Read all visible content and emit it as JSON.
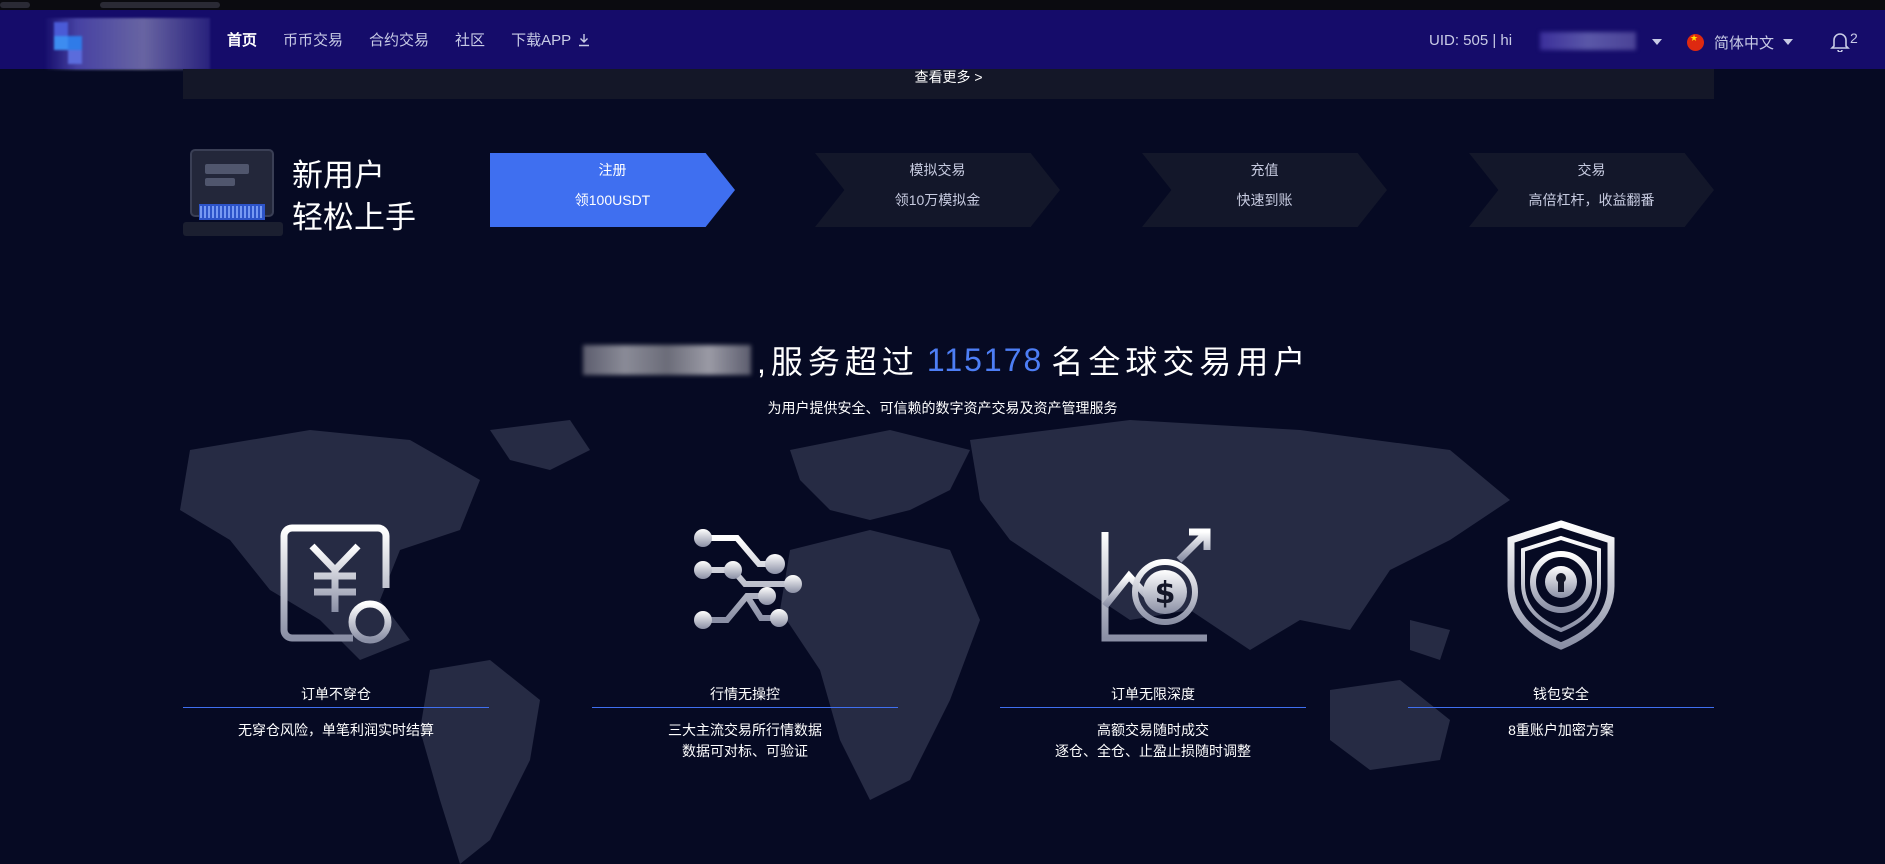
{
  "nav": {
    "links": [
      "首页",
      "币币交易",
      "合约交易",
      "社区",
      "下载APP"
    ],
    "uid": "UID: 505  |  hi",
    "language": "简体中文",
    "notification_count": "2"
  },
  "more": {
    "label": "查看更多 >"
  },
  "new_user": {
    "title_line1": "新用户",
    "title_line2": "轻松上手",
    "steps": [
      {
        "title": "注册",
        "desc": "领100USDT"
      },
      {
        "title": "模拟交易",
        "desc": "领10万模拟金"
      },
      {
        "title": "充值",
        "desc": "快速到账"
      },
      {
        "title": "交易",
        "desc": "高倍杠杆，收益翻番"
      }
    ]
  },
  "hero": {
    "prefix": ",服务超过",
    "count": "115178",
    "suffix": "名全球交易用户",
    "subtitle": "为用户提供安全、可信赖的数字资产交易及资产管理服务"
  },
  "features": [
    {
      "name": "订单不穿仓",
      "desc1": "无穿仓风险，单笔利润实时结算",
      "desc2": ""
    },
    {
      "name": "行情无操控",
      "desc1": "三大主流交易所行情数据",
      "desc2": "数据可对标、可验证"
    },
    {
      "name": "订单无限深度",
      "desc1": "高额交易随时成交",
      "desc2": "逐仓、全仓、止盈止损随时调整"
    },
    {
      "name": "钱包安全",
      "desc1": "8重账户加密方案",
      "desc2": ""
    }
  ],
  "colors": {
    "nav_bg": "#150c6a",
    "accent": "#3f6ff0",
    "page_bg": "#060a23",
    "step_bg": "#13172a"
  },
  "icons": [
    "download-icon",
    "caret-down-icon",
    "china-flag-icon",
    "bell-icon",
    "laptop-icon",
    "yen-document-icon",
    "network-nodes-icon",
    "dollar-growth-chart-icon",
    "shield-lock-icon"
  ]
}
